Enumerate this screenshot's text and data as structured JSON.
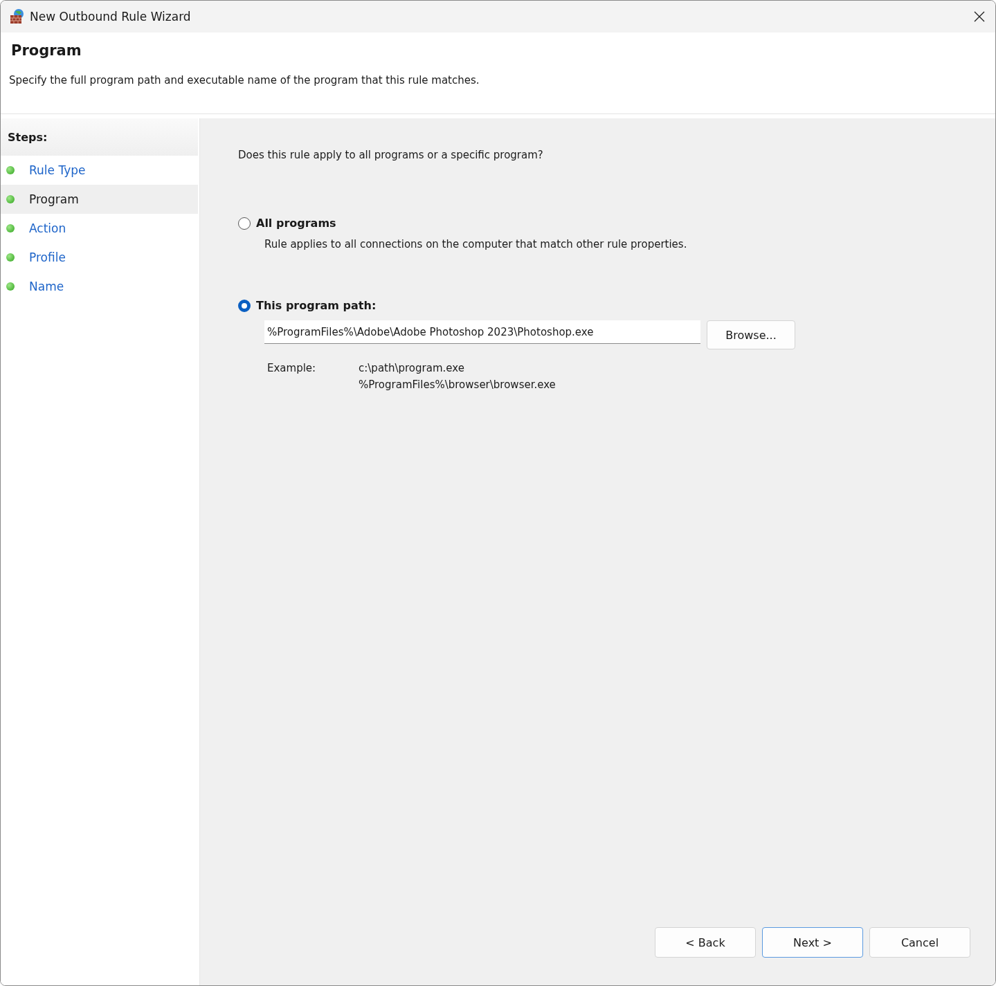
{
  "window": {
    "title": "New Outbound Rule Wizard"
  },
  "header": {
    "title": "Program",
    "description": "Specify the full program path and executable name of the program that this rule matches."
  },
  "steps": {
    "title": "Steps:",
    "items": [
      {
        "label": "Rule Type",
        "selected": false
      },
      {
        "label": "Program",
        "selected": true
      },
      {
        "label": "Action",
        "selected": false
      },
      {
        "label": "Profile",
        "selected": false
      },
      {
        "label": "Name",
        "selected": false
      }
    ]
  },
  "question": "Does this rule apply to all programs or a specific program?",
  "options": [
    {
      "kind": "plain",
      "label": "All programs",
      "selected": false,
      "description": "Rule applies to all connections on the computer that match other rule properties."
    },
    {
      "kind": "path",
      "label": "This program path:",
      "selected": true,
      "value": "%ProgramFiles%\\Adobe\\Adobe Photoshop 2023\\Photoshop.exe",
      "browse": "Browse...",
      "example_label": "Example:",
      "examples": [
        "c:\\path\\program.exe",
        "%ProgramFiles%\\browser\\browser.exe"
      ]
    }
  ],
  "buttons": [
    {
      "label": "< Back",
      "default": false
    },
    {
      "label": "Next >",
      "default": true
    },
    {
      "label": "Cancel",
      "default": false
    }
  ]
}
